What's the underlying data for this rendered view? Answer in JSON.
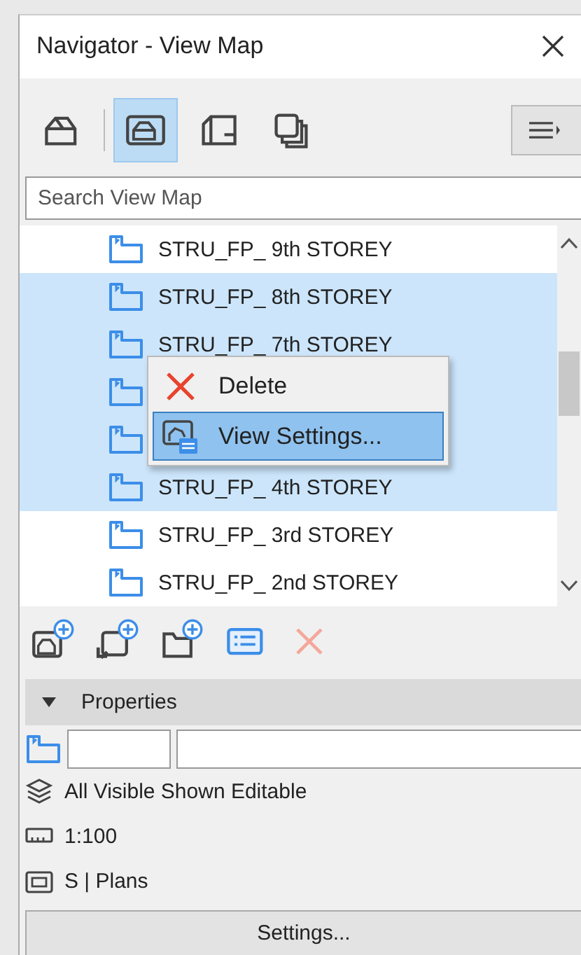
{
  "window": {
    "title": "Navigator - View Map"
  },
  "toolbar": {
    "modes": [
      {
        "kind": "project",
        "selected": false
      },
      {
        "kind": "viewmap",
        "selected": true
      },
      {
        "kind": "layout",
        "selected": false
      },
      {
        "kind": "publisher",
        "selected": false
      }
    ]
  },
  "search": {
    "placeholder": "Search View Map"
  },
  "views": [
    {
      "name": "STRU_FP_ 9th STOREY",
      "selected": false
    },
    {
      "name": "STRU_FP_ 8th STOREY",
      "selected": true
    },
    {
      "name": "STRU_FP_ 7th STOREY",
      "selected": true
    },
    {
      "selected": true
    },
    {
      "selected": true
    },
    {
      "name": "STRU_FP_ 4th STOREY",
      "selected": true
    },
    {
      "name": "STRU_FP_ 3rd STOREY",
      "selected": false
    },
    {
      "name": "STRU_FP_ 2nd STOREY",
      "selected": false
    }
  ],
  "context_menu": [
    {
      "kind": "delete",
      "label": "Delete",
      "selected": false
    },
    {
      "kind": "settings",
      "label": "View Settings...",
      "selected": true
    }
  ],
  "actions": [
    {
      "kind": "new-view"
    },
    {
      "kind": "clone"
    },
    {
      "kind": "new-folder"
    },
    {
      "kind": "settings"
    },
    {
      "kind": "delete",
      "disabled": true
    }
  ],
  "properties": {
    "title": "Properties",
    "expanded": true,
    "rows": [
      {
        "kind": "layers",
        "text": "All Visible Shown Editable"
      },
      {
        "kind": "scale",
        "text": "1:100"
      },
      {
        "kind": "structure",
        "text": "S | Plans"
      }
    ],
    "button": "Settings..."
  }
}
